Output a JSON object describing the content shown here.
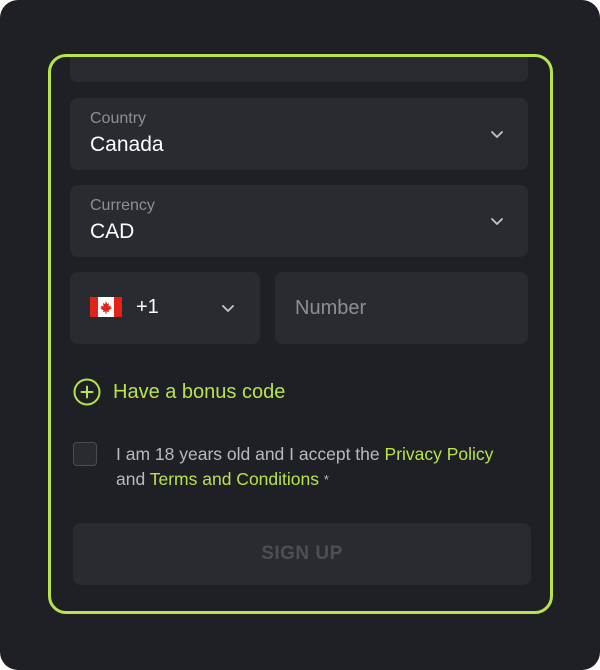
{
  "form": {
    "country": {
      "label": "Country",
      "value": "Canada"
    },
    "currency": {
      "label": "Currency",
      "value": "CAD"
    },
    "phone": {
      "flag_icon": "canada-flag-icon",
      "dial_code": "+1",
      "number_placeholder": "Number"
    },
    "bonus": {
      "icon": "plus-circle-icon",
      "label": "Have a bonus code"
    },
    "terms": {
      "text_1": "I am 18 years old and I accept the",
      "privacy_link": "Privacy Policy",
      "text_2": "and",
      "terms_link": "Terms and Conditions",
      "required_mark": "*"
    },
    "signup_label": "SIGN UP"
  },
  "colors": {
    "background": "#1f2025",
    "field": "#2a2b31",
    "accent": "#b8e34a",
    "muted": "#8d8f96"
  }
}
